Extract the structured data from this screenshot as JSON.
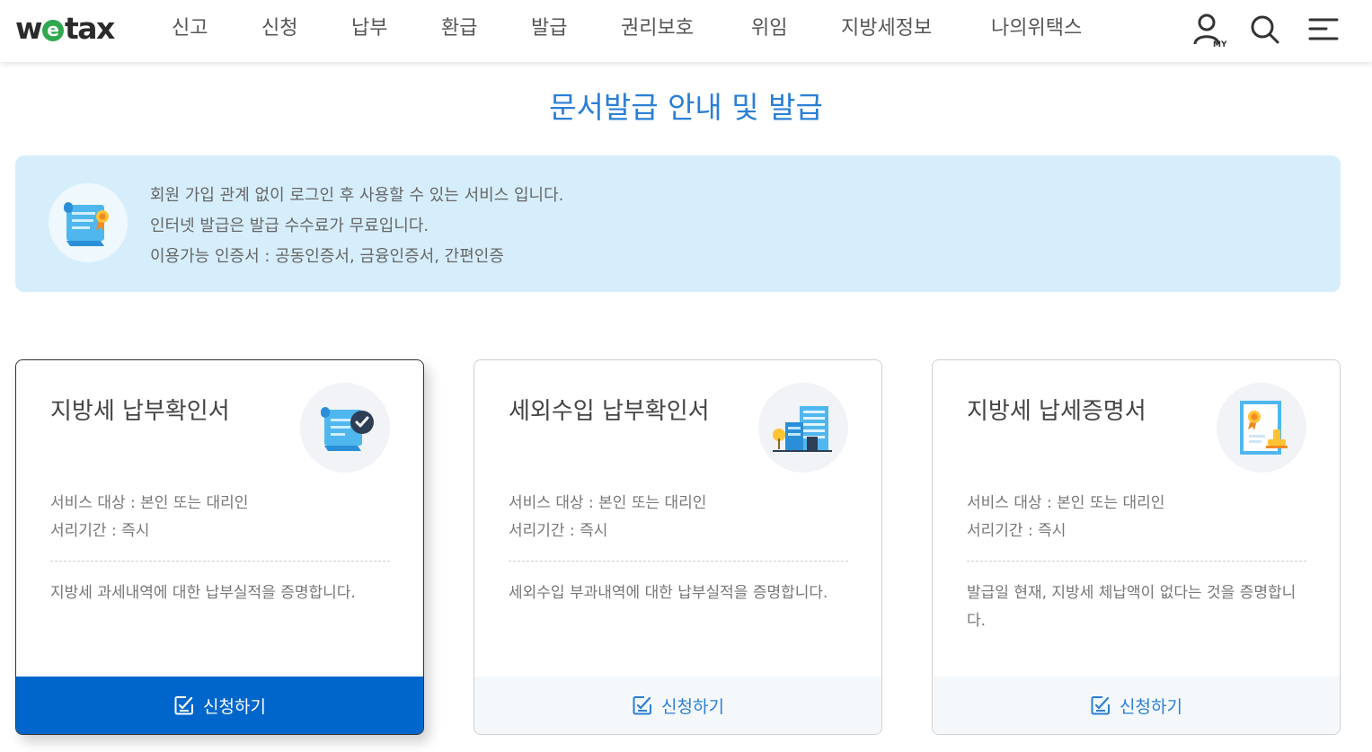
{
  "header": {
    "logo": {
      "prefix": "w",
      "e": "e",
      "suffix": "tax"
    },
    "nav": [
      "신고",
      "신청",
      "납부",
      "환급",
      "발급",
      "권리보호",
      "위임",
      "지방세정보",
      "나의위택스"
    ],
    "icons": [
      "my-page-icon",
      "search-icon",
      "menu-icon"
    ],
    "my_label": "MY"
  },
  "page_title": "문서발급 안내 및 발급",
  "info": {
    "lines": [
      "회원 가입 관계 없이 로그인 후 사용할 수 있는 서비스 입니다.",
      "인터넷 발급은 발급 수수료가 무료입니다.",
      "이용가능 인증서 : 공동인증서, 금융인증서, 간편인증"
    ]
  },
  "cards": [
    {
      "title": "지방세 납부확인서",
      "target": "서비스 대상 : 본인 또는 대리인",
      "period": "서리기간 : 즉시",
      "desc": "지방세 과세내역에 대한 납부실적을 증명합니다.",
      "button": "신청하기",
      "icon": "document-check-icon"
    },
    {
      "title": "세외수입 납부확인서",
      "target": "서비스 대상 : 본인 또는 대리인",
      "period": "서리기간 : 즉시",
      "desc": "세외수입 부과내역에 대한 납부실적을 증명합니다.",
      "button": "신청하기",
      "icon": "buildings-icon"
    },
    {
      "title": "지방세 납세증명서",
      "target": "서비스 대상 : 본인 또는 대리인",
      "period": "서리기간 : 즉시",
      "desc": "발급일 현재, 지방세 체납액이 없다는 것을 증명합니다.",
      "button": "신청하기",
      "icon": "certificate-stamp-icon"
    }
  ],
  "colors": {
    "accent": "#2a7fd6",
    "primary_button": "#0066cc",
    "info_bg": "#d6eefb",
    "logo_e": "#2fa84f"
  }
}
